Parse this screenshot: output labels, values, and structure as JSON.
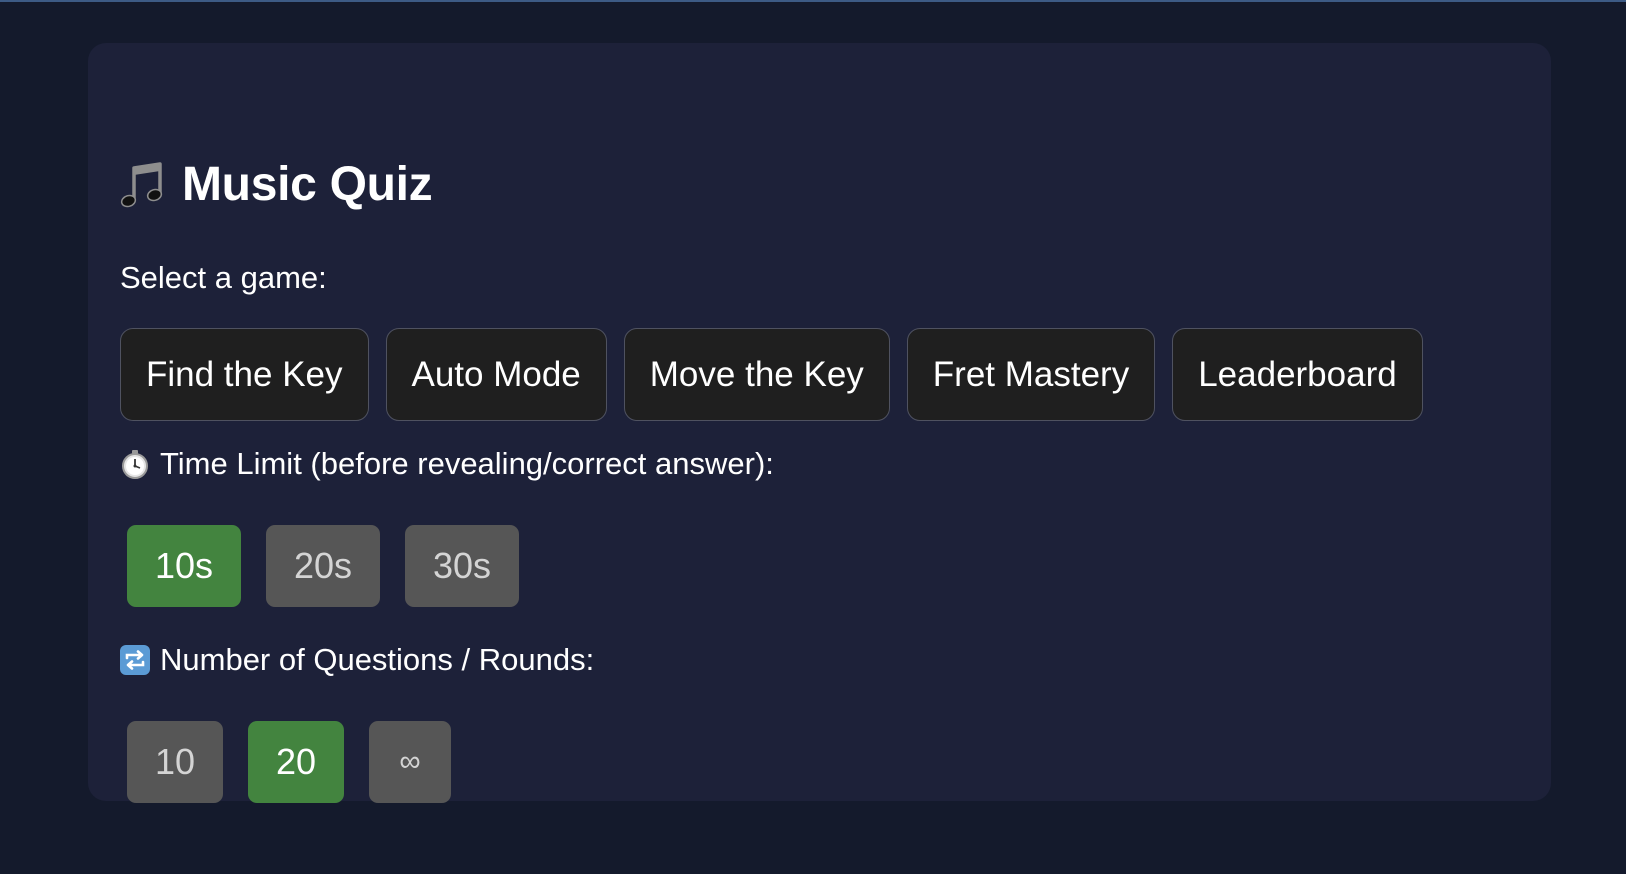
{
  "quiz": {
    "title": "Music Quiz",
    "title_icon": "music-notes-icon",
    "select_prompt": "Select a game:",
    "games": [
      {
        "label": "Find the Key"
      },
      {
        "label": "Auto Mode"
      },
      {
        "label": "Move the Key"
      },
      {
        "label": "Fret Mastery"
      },
      {
        "label": "Leaderboard"
      }
    ],
    "time_limit": {
      "icon": "stopwatch-icon",
      "label": "Time Limit (before revealing/correct answer):",
      "options": [
        "10s",
        "20s",
        "30s"
      ],
      "selected": "10s"
    },
    "rounds": {
      "icon": "repeat-icon",
      "label": "Number of Questions / Rounds:",
      "options": [
        "10",
        "20",
        "∞"
      ],
      "selected": "20"
    }
  },
  "colors": {
    "page_background": "#141a2c",
    "card_background": "#1d2139",
    "game_button_background": "#1f1f1f",
    "chip_inactive": "#565656",
    "chip_active": "#43843f"
  }
}
